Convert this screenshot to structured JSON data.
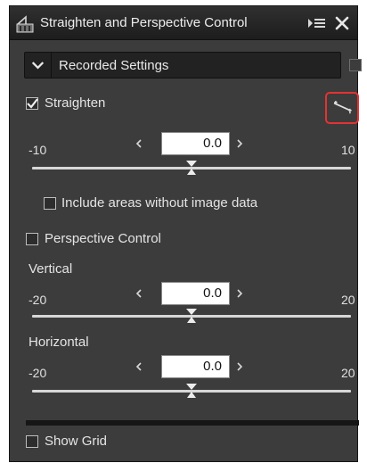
{
  "window": {
    "title": "Straighten and Perspective Control"
  },
  "settings_dropdown": {
    "selected": "Recorded Settings"
  },
  "straighten": {
    "label": "Straighten",
    "checked": true,
    "min": "-10",
    "max": "10",
    "value": "0.0",
    "slider_fraction": 0.5
  },
  "include_areas": {
    "label": "Include areas without image data",
    "checked": false
  },
  "perspective": {
    "label": "Perspective Control",
    "checked": false
  },
  "vertical": {
    "label": "Vertical",
    "min": "-20",
    "max": "20",
    "value": "0.0",
    "slider_fraction": 0.5
  },
  "horizontal": {
    "label": "Horizontal",
    "min": "-20",
    "max": "20",
    "value": "0.0",
    "slider_fraction": 0.5
  },
  "show_grid": {
    "label": "Show Grid",
    "checked": false
  },
  "colors": {
    "panel": "#3c3c3c",
    "titlebar": "#1d1d1d",
    "highlight": "#e53232",
    "value_bg": "#ffffff"
  },
  "icons": [
    "app-icon",
    "panel-menu-icon",
    "close-icon",
    "dropdown-chevron-icon",
    "straighten-crop-tool-icon",
    "stepper-left-icon",
    "stepper-right-icon",
    "slider-thumb-icon",
    "checkmark-icon"
  ]
}
